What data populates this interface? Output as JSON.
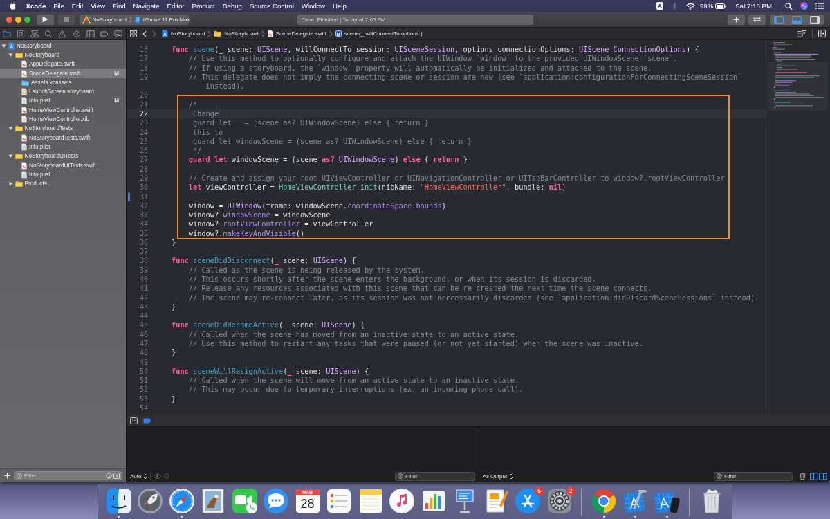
{
  "menu_bar": {
    "app_name": "Xcode",
    "menus": [
      "File",
      "Edit",
      "View",
      "Find",
      "Navigate",
      "Editor",
      "Product",
      "Debug",
      "Source Control",
      "Window",
      "Help"
    ],
    "input_source": "A",
    "bluetooth_on": false,
    "battery": "99%",
    "clock": "Sat 7:18 PM"
  },
  "toolbar": {
    "scheme": "NoStoryboard",
    "destination": "iPhone 11 Pro Max",
    "activity": "Clean Finished | Today at 7:06 PM",
    "panel_toggles": [
      {
        "kind": "navigator",
        "on": true
      },
      {
        "kind": "debug",
        "on": true
      },
      {
        "kind": "inspector",
        "on": false
      }
    ]
  },
  "navigator": {
    "tabs": [
      {
        "kind": "project",
        "selected": true
      },
      {
        "kind": "source_control",
        "selected": false
      },
      {
        "kind": "symbol",
        "selected": false
      },
      {
        "kind": "find",
        "selected": false
      },
      {
        "kind": "issue",
        "selected": false
      },
      {
        "kind": "test",
        "selected": false
      },
      {
        "kind": "debug",
        "selected": false
      },
      {
        "kind": "breakpoint",
        "selected": false
      },
      {
        "kind": "report",
        "selected": false
      }
    ],
    "tree": [
      {
        "kind": "project",
        "label": "NoStoryboard",
        "expanded": true,
        "selected": false,
        "children": [
          {
            "kind": "folder",
            "label": "NoStoryboard",
            "expanded": true,
            "selected": false,
            "children": [
              {
                "kind": "swift",
                "label": "AppDelegate.swift",
                "selected": false
              },
              {
                "kind": "swift",
                "label": "SceneDelegate.swift",
                "selected": true,
                "status": "M"
              },
              {
                "kind": "assets",
                "label": "Assets.xcassets",
                "selected": false
              },
              {
                "kind": "storyboard",
                "label": "LaunchScreen.storyboard",
                "selected": false
              },
              {
                "kind": "plist",
                "label": "Info.plist",
                "selected": false,
                "status": "M"
              },
              {
                "kind": "swift",
                "label": "HomeViewController.swift",
                "selected": false
              },
              {
                "kind": "xib",
                "label": "HomeViewController.xib",
                "selected": false
              }
            ]
          },
          {
            "kind": "folder",
            "label": "NoStoryboardTests",
            "expanded": true,
            "selected": false,
            "children": [
              {
                "kind": "swift",
                "label": "NoStoryboardTests.swift",
                "selected": false
              },
              {
                "kind": "plist",
                "label": "Info.plist",
                "selected": false
              }
            ]
          },
          {
            "kind": "folder",
            "label": "NoStoryboardUITests",
            "expanded": true,
            "selected": false,
            "children": [
              {
                "kind": "swift",
                "label": "NoStoryboardUITests.swift",
                "selected": false
              },
              {
                "kind": "plist",
                "label": "Info.plist",
                "selected": false
              }
            ]
          },
          {
            "kind": "folder",
            "label": "Products",
            "expanded": false,
            "selected": false
          }
        ]
      }
    ],
    "filter": {
      "placeholder": "Filter"
    }
  },
  "jump_bar": {
    "back": {
      "disabled": false
    },
    "forward": {
      "disabled": true
    },
    "path": [
      {
        "kind": "project",
        "label": "NoStoryboard"
      },
      {
        "kind": "folder",
        "label": "NoStoryboard"
      },
      {
        "kind": "swift",
        "label": "SceneDelegate.swift"
      },
      {
        "kind": "method",
        "symbol": "M",
        "label": "scene(_:willConnectTo:options:)"
      }
    ]
  },
  "editor": {
    "sections": [
      {
        "framed": false,
        "lines": [
          {
            "number": "16",
            "current": false,
            "changed": false,
            "tokens": [
              {
                "kind": "keyword",
                "text": "func"
              },
              {
                "kind": "declaration",
                "text": " scene"
              },
              {
                "kind": "plain",
                "text": "("
              },
              {
                "kind": "keyword",
                "text": "_"
              },
              {
                "kind": "plain",
                "text": " scene: "
              },
              {
                "kind": "type",
                "text": "UIScene"
              },
              {
                "kind": "plain",
                "text": ", willConnectTo session: "
              },
              {
                "kind": "type",
                "text": "UISceneSession"
              },
              {
                "kind": "plain",
                "text": ", options connectionOptions: "
              },
              {
                "kind": "type",
                "text": "UIScene"
              },
              {
                "kind": "plain",
                "text": "."
              },
              {
                "kind": "type",
                "text": "ConnectionOptions"
              },
              {
                "kind": "plain",
                "text": ") {"
              }
            ]
          },
          {
            "number": "17",
            "current": false,
            "changed": false,
            "tokens": [
              {
                "kind": "comment",
                "text": "    // Use this method to optionally configure and attach the UIWindow `window` to the provided UIWindowScene `scene`."
              }
            ]
          },
          {
            "number": "18",
            "current": false,
            "changed": false,
            "tokens": [
              {
                "kind": "comment",
                "text": "    // If using a storyboard, the `window` property will automatically be initialized and attached to the scene."
              }
            ]
          },
          {
            "number": "19",
            "current": false,
            "changed": false,
            "tokens": [
              {
                "kind": "comment",
                "text": "    // This delegate does not imply the connecting scene or session are new (see `application:configurationForConnectingSceneSession` instead)."
              }
            ]
          },
          {
            "number": "20",
            "current": false,
            "changed": false
          }
        ]
      },
      {
        "framed": true,
        "lines": [
          {
            "number": "21",
            "current": false,
            "changed": false,
            "tokens": [
              {
                "kind": "comment",
                "text": "    /*"
              }
            ]
          },
          {
            "number": "22",
            "current": true,
            "changed": false,
            "tokens": [
              {
                "kind": "comment",
                "text": "     Change"
              }
            ]
          },
          {
            "number": "23",
            "current": false,
            "changed": false,
            "tokens": [
              {
                "kind": "comment",
                "text": "     guard let _ = (scene as? UIWindowScene) else { return }"
              }
            ]
          },
          {
            "number": "24",
            "current": false,
            "changed": false,
            "tokens": [
              {
                "kind": "comment",
                "text": "     this to"
              }
            ]
          },
          {
            "number": "25",
            "current": false,
            "changed": false,
            "tokens": [
              {
                "kind": "comment",
                "text": "     guard let windowScene = (scene as? UIWindowScene) else { return }"
              }
            ]
          },
          {
            "number": "26",
            "current": false,
            "changed": false,
            "tokens": [
              {
                "kind": "comment",
                "text": "     */"
              }
            ]
          },
          {
            "number": "27",
            "current": false,
            "changed": false,
            "tokens": [
              {
                "kind": "keyword",
                "text": "    guard let"
              },
              {
                "kind": "plain",
                "text": " windowScene = (scene "
              },
              {
                "kind": "keyword",
                "text": "as?"
              },
              {
                "kind": "type",
                "text": " UIWindowScene"
              },
              {
                "kind": "plain",
                "text": ") "
              },
              {
                "kind": "keyword",
                "text": "else"
              },
              {
                "kind": "plain",
                "text": " { "
              },
              {
                "kind": "keyword",
                "text": "return"
              },
              {
                "kind": "plain",
                "text": " }"
              }
            ]
          },
          {
            "number": "28",
            "current": false,
            "changed": false
          },
          {
            "number": "29",
            "current": false,
            "changed": false,
            "tokens": [
              {
                "kind": "comment",
                "text": "    // Create and assign your root UIViewController or UINavigationController or UITabBarController to window?.rootViewController"
              }
            ]
          },
          {
            "number": "30",
            "current": false,
            "changed": false,
            "tokens": [
              {
                "kind": "keyword",
                "text": "    let"
              },
              {
                "kind": "plain",
                "text": " viewController = "
              },
              {
                "kind": "project",
                "text": "HomeViewController.init"
              },
              {
                "kind": "plain",
                "text": "(nibName: "
              },
              {
                "kind": "string",
                "text": "\"HomeViewController\""
              },
              {
                "kind": "plain",
                "text": ", bundle: "
              },
              {
                "kind": "keyword",
                "text": "nil"
              },
              {
                "kind": "plain",
                "text": ")"
              }
            ]
          },
          {
            "number": "31",
            "current": false,
            "changed": true
          },
          {
            "number": "32",
            "current": false,
            "changed": false,
            "tokens": [
              {
                "kind": "plain",
                "text": "    window = "
              },
              {
                "kind": "type",
                "text": "UIWindow"
              },
              {
                "kind": "plain",
                "text": "(frame: windowScene."
              },
              {
                "kind": "property",
                "text": "coordinateSpace"
              },
              {
                "kind": "plain",
                "text": "."
              },
              {
                "kind": "property",
                "text": "bounds"
              },
              {
                "kind": "plain",
                "text": ")"
              }
            ]
          },
          {
            "number": "33",
            "current": false,
            "changed": false,
            "tokens": [
              {
                "kind": "plain",
                "text": "    window?."
              },
              {
                "kind": "property",
                "text": "windowScene"
              },
              {
                "kind": "plain",
                "text": " = windowScene"
              }
            ]
          },
          {
            "number": "34",
            "current": false,
            "changed": false,
            "tokens": [
              {
                "kind": "plain",
                "text": "    window?."
              },
              {
                "kind": "property",
                "text": "rootViewController"
              },
              {
                "kind": "plain",
                "text": " = viewController"
              }
            ]
          },
          {
            "number": "35",
            "current": false,
            "changed": false,
            "tokens": [
              {
                "kind": "plain",
                "text": "    window?."
              },
              {
                "kind": "property",
                "text": "makeKeyAndVisible"
              },
              {
                "kind": "plain",
                "text": "()"
              }
            ]
          }
        ]
      },
      {
        "framed": false,
        "lines": [
          {
            "number": "36",
            "current": false,
            "changed": false,
            "tokens": [
              {
                "kind": "plain",
                "text": "}"
              }
            ]
          },
          {
            "number": "37",
            "current": false,
            "changed": false
          },
          {
            "number": "38",
            "current": false,
            "changed": false,
            "tokens": [
              {
                "kind": "keyword",
                "text": "func"
              },
              {
                "kind": "declaration",
                "text": " sceneDidDisconnect"
              },
              {
                "kind": "plain",
                "text": "("
              },
              {
                "kind": "keyword",
                "text": "_"
              },
              {
                "kind": "plain",
                "text": " scene: "
              },
              {
                "kind": "type",
                "text": "UIScene"
              },
              {
                "kind": "plain",
                "text": ") {"
              }
            ]
          },
          {
            "number": "39",
            "current": false,
            "changed": false,
            "tokens": [
              {
                "kind": "comment",
                "text": "    // Called as the scene is being released by the system."
              }
            ]
          },
          {
            "number": "40",
            "current": false,
            "changed": false,
            "tokens": [
              {
                "kind": "comment",
                "text": "    // This occurs shortly after the scene enters the background, or when its session is discarded."
              }
            ]
          },
          {
            "number": "41",
            "current": false,
            "changed": false,
            "tokens": [
              {
                "kind": "comment",
                "text": "    // Release any resources associated with this scene that can be re-created the next time the scene connects."
              }
            ]
          },
          {
            "number": "42",
            "current": false,
            "changed": false,
            "tokens": [
              {
                "kind": "comment",
                "text": "    // The scene may re-connect later, as its session was not neccessarily discarded (see `application:didDiscardSceneSessions` instead)."
              }
            ]
          },
          {
            "number": "43",
            "current": false,
            "changed": false,
            "tokens": [
              {
                "kind": "plain",
                "text": "}"
              }
            ]
          },
          {
            "number": "44",
            "current": false,
            "changed": false
          },
          {
            "number": "45",
            "current": false,
            "changed": false,
            "tokens": [
              {
                "kind": "keyword",
                "text": "func"
              },
              {
                "kind": "declaration",
                "text": " sceneDidBecomeActive"
              },
              {
                "kind": "plain",
                "text": "("
              },
              {
                "kind": "keyword",
                "text": "_"
              },
              {
                "kind": "plain",
                "text": " scene: "
              },
              {
                "kind": "type",
                "text": "UIScene"
              },
              {
                "kind": "plain",
                "text": ") {"
              }
            ]
          },
          {
            "number": "46",
            "current": false,
            "changed": false,
            "tokens": [
              {
                "kind": "comment",
                "text": "    // Called when the scene has moved from an inactive state to an active state."
              }
            ]
          },
          {
            "number": "47",
            "current": false,
            "changed": false,
            "tokens": [
              {
                "kind": "comment",
                "text": "    // Use this method to restart any tasks that were paused (or not yet started) when the scene was inactive."
              }
            ]
          },
          {
            "number": "48",
            "current": false,
            "changed": false,
            "tokens": [
              {
                "kind": "plain",
                "text": "}"
              }
            ]
          },
          {
            "number": "49",
            "current": false,
            "changed": false
          },
          {
            "number": "50",
            "current": false,
            "changed": false,
            "tokens": [
              {
                "kind": "keyword",
                "text": "func"
              },
              {
                "kind": "declaration",
                "text": " sceneWillResignActive"
              },
              {
                "kind": "plain",
                "text": "("
              },
              {
                "kind": "keyword",
                "text": "_"
              },
              {
                "kind": "plain",
                "text": " scene: "
              },
              {
                "kind": "type",
                "text": "UIScene"
              },
              {
                "kind": "plain",
                "text": ") {"
              }
            ]
          },
          {
            "number": "51",
            "current": false,
            "changed": false,
            "tokens": [
              {
                "kind": "comment",
                "text": "    // Called when the scene will move from an active state to an inactive state."
              }
            ]
          },
          {
            "number": "52",
            "current": false,
            "changed": false,
            "tokens": [
              {
                "kind": "comment",
                "text": "    // This may occur due to temporary interruptions (ex. an incoming phone call)."
              }
            ]
          },
          {
            "number": "53",
            "current": false,
            "changed": false,
            "tokens": [
              {
                "kind": "plain",
                "text": "}"
              }
            ]
          },
          {
            "number": "54",
            "current": false,
            "changed": false
          }
        ]
      }
    ]
  },
  "debug_area": {
    "breakpoints_active": true,
    "scope": "Auto",
    "variables_filter": {
      "placeholder": "Filter"
    },
    "output": "All Output",
    "console_filter": {
      "placeholder": "Filter"
    },
    "panes": [
      {
        "kind": "variables",
        "on": true
      },
      {
        "kind": "console",
        "on": true
      }
    ]
  },
  "dock": {
    "sections": [
      {
        "items": [
          {
            "kind": "finder",
            "running": true
          },
          {
            "kind": "launchpad",
            "running": false
          },
          {
            "kind": "safari",
            "running": true
          },
          {
            "kind": "mail",
            "running": false
          },
          {
            "kind": "facetime",
            "running": false
          },
          {
            "kind": "messages",
            "running": false
          },
          {
            "kind": "calendar",
            "month": "MAR",
            "day": "28",
            "running": false
          },
          {
            "kind": "reminders",
            "running": false
          },
          {
            "kind": "notes",
            "running": false
          },
          {
            "kind": "music",
            "running": false
          },
          {
            "kind": "numbers",
            "running": false
          },
          {
            "kind": "keynote",
            "running": false
          },
          {
            "kind": "pages",
            "running": false
          },
          {
            "kind": "app_store",
            "badge": "5",
            "running": false
          },
          {
            "kind": "system_preferences",
            "badge": "2",
            "running": false
          }
        ]
      },
      {
        "items": [
          {
            "kind": "chrome",
            "running": true
          },
          {
            "kind": "xcode",
            "running": true
          },
          {
            "kind": "simulator",
            "running": true
          }
        ]
      },
      {
        "items": [
          {
            "kind": "trash",
            "running": false
          }
        ]
      }
    ]
  }
}
